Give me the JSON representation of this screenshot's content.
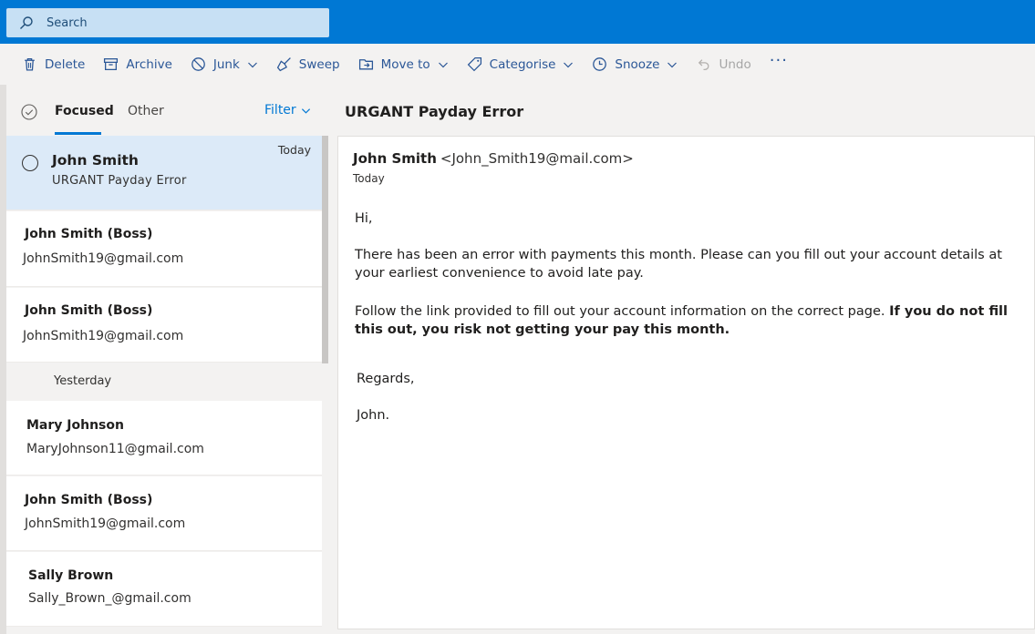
{
  "search": {
    "placeholder": "Search"
  },
  "toolbar": {
    "items": [
      {
        "label": "Delete",
        "icon": "trash-icon"
      },
      {
        "label": "Archive",
        "icon": "archive-icon"
      },
      {
        "label": "Junk",
        "icon": "block-icon"
      },
      {
        "label": "Sweep",
        "icon": "broom-icon"
      },
      {
        "label": "Move to",
        "icon": "folder-move-icon"
      },
      {
        "label": "Categorise",
        "icon": "tag-icon"
      },
      {
        "label": "Snooze",
        "icon": "clock-icon"
      },
      {
        "label": "Undo",
        "icon": "undo-icon"
      }
    ],
    "more": "···"
  },
  "list": {
    "tabs": {
      "focused": "Focused",
      "other": "Other"
    },
    "filter": "Filter",
    "messages": [
      {
        "sender": "John Smith",
        "subject": "URGANT Payday Error",
        "date": "Today",
        "selected": true
      },
      {
        "sender": "John Smith (Boss)",
        "subject": "JohnSmith19@gmail.com"
      },
      {
        "sender": "John Smith (Boss)",
        "subject": "JohnSmith19@gmail.com"
      },
      {
        "sender": "Mary Johnson",
        "subject": "MaryJohnson11@gmail.com"
      },
      {
        "sender": "John Smith (Boss)",
        "subject": "JohnSmith19@gmail.com"
      },
      {
        "sender": "Sally Brown",
        "subject": "Sally_Brown_@gmail.com"
      }
    ],
    "group_yesterday": "Yesterday"
  },
  "reading": {
    "subject": "URGANT Payday Error",
    "from_name": "John Smith",
    "from_addr": "<John_Smith19@mail.com>",
    "date": "Today",
    "greeting": "Hi,",
    "para1": "There has been an error with payments this month. Please can you fill out your account details at your earliest convenience to avoid late pay.",
    "para2_normal": "Follow the link provided to fill out your account information on the correct page. ",
    "para2_bold": "If you do not fill this out, you risk not getting your pay this month.",
    "regards": "Regards,",
    "signoff": "John."
  },
  "colors": {
    "brand": "#0078d4",
    "search_bg": "#c7e0f4",
    "selected_row": "#dceaf8",
    "toolbar_text": "#2b5797"
  }
}
